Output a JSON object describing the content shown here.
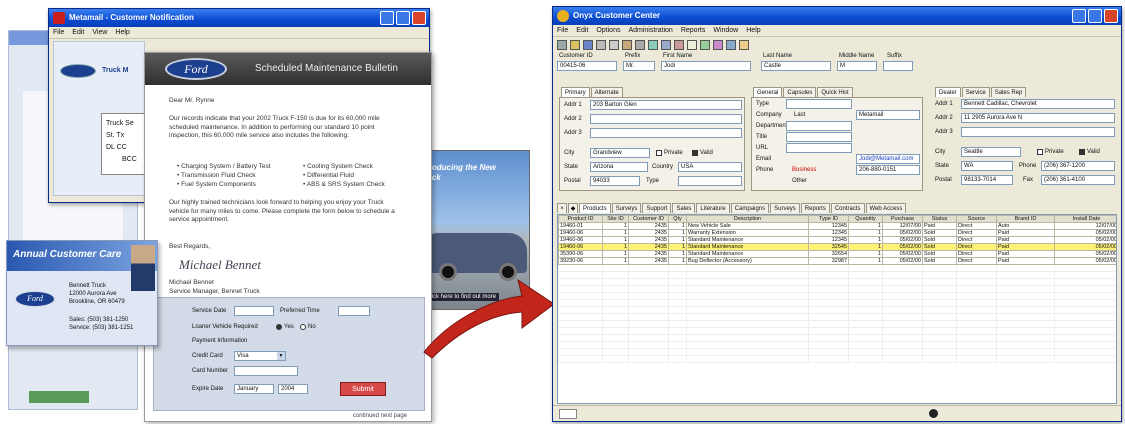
{
  "left_back": {
    "title": "Metamail - Customer Notification",
    "menu": [
      "File",
      "Edit",
      "View",
      "Help"
    ],
    "truck_label": "Truck M",
    "panel_lines": [
      "Truck Se",
      "St. Tx",
      "DL   CC",
      "BCC"
    ]
  },
  "bulletin": {
    "brand": "Ford",
    "header_title": "Scheduled Maintenance Bulletin",
    "greeting": "Dear Mr. Rynne",
    "para1": "Our records indicate that your 2002 Truck F-150 is due for its 60,000 mile scheduled maintenance. In addition to performing our standard 10 point inspection, this 60,000 mile service also includes the following:",
    "checklist": [
      "Charging System / Battery Test",
      "Transmission Fluid Check",
      "Fuel System Components",
      "Cooling System Check",
      "Differential Fluid",
      "ABS & SRS System Check"
    ],
    "para2": "Our highly trained technicians look forward to helping you enjoy your Truck vehicle for many miles to come. Please complete the form below to schedule a service appointment.",
    "closing": "Best Regards,",
    "signature": "Michael Bennet",
    "sig_name": "Michael Bennet",
    "sig_title": "Service Manager, Bennet Truck",
    "form": {
      "service_date": "Service Date",
      "preferred_time": "Preferred Time",
      "loaner": "Loaner Vehicle Required",
      "yes": "Yes",
      "no": "No",
      "payment": "Payment Information",
      "credit_card": "Credit Card",
      "credit_card_value": "Visa",
      "card_number": "Card Number",
      "expire_date": "Expire Date",
      "expire_month": "January",
      "expire_year": "2004",
      "submit": "Submit"
    },
    "footer": "continued next page"
  },
  "promo": {
    "headline": "Introducing the New Truck",
    "caption": "Click here to find out more"
  },
  "card": {
    "title": "Annual Customer Care",
    "brand": "Ford",
    "company": "Bennett Truck",
    "addr1": "12000 Aurora Ave",
    "addr2": "Brookline, OR 60479",
    "sales": "Sales: (503) 381-1250",
    "service": "Service: (503) 381-1251"
  },
  "onyx": {
    "title": "Onyx Customer Center",
    "menu": [
      "File",
      "Edit",
      "Options",
      "Administration",
      "Reports",
      "Window",
      "Help"
    ],
    "name_labels": [
      "Customer ID",
      "Prefix",
      "First Name",
      "Last Name",
      "Middle Name",
      "Suffix"
    ],
    "name_values": [
      "00415-06",
      "Mr.",
      "Jodi",
      "Castle",
      "M",
      ""
    ],
    "addr_tabs": [
      "Primary",
      "Alternate"
    ],
    "addr_labels": [
      "Addr 1",
      "Addr 2",
      "Addr 3",
      "City",
      "State",
      "Postal",
      "Country",
      "Type"
    ],
    "addr1": "203 Barton Glen",
    "city": "Grandview",
    "state": "Arizona",
    "postal": "94033",
    "country": "USA",
    "private": "Private",
    "valid": "Valid",
    "gen_tabs": [
      "General",
      "Capsules",
      "Quick Hist"
    ],
    "gen_labels": [
      "Type",
      "Company",
      "Department",
      "Title",
      "URL",
      "Email",
      "Phone",
      "Other"
    ],
    "company_value": "Metamail",
    "last_label": "Last",
    "email_value": "Jodi@Metamail.com",
    "phone_type": "Business",
    "phone_value": "206-880-0151",
    "dealer_tabs": [
      "Dealer",
      "Service",
      "Sales Rep"
    ],
    "dealer_addr1": "Bennett Cadillac, Chevrolet",
    "dealer_addr2": "11 2905 Aurora Ave N",
    "dealer_city": "Seattle",
    "dealer_state": "WA",
    "dealer_postal": "98133-7014",
    "dealer_phone_label": "Phone",
    "dealer_phone": "(206) 367-1200",
    "dealer_fax_label": "Fax",
    "dealer_fax": "(206) 361-4100",
    "bottom_tabs": [
      "Products",
      "Surveys",
      "Support",
      "Sales",
      "Literature",
      "Campaigns",
      "Surveys",
      "Reports",
      "Contracts",
      "Web Access"
    ],
    "columns": [
      "Product ID",
      "Site ID",
      "Customer ID",
      "Qty",
      "Description",
      "Type ID",
      "Quantity",
      "Purchase",
      "Status",
      "Source",
      "Brand ID",
      "Install Date"
    ],
    "rows": [
      [
        "19460-01",
        "1",
        "2435",
        "1",
        "New Vehicle Sale",
        "12345",
        "1",
        "12/07/00",
        "Paid",
        "Direct",
        "Auto",
        "12/07/00"
      ],
      [
        "19460-06",
        "1",
        "2435",
        "1",
        "Warranty Extension",
        "12345",
        "1",
        "05/02/00",
        "Sold",
        "Direct",
        "Paid",
        "05/02/00"
      ],
      [
        "19460-06",
        "1",
        "2435",
        "1",
        "Standard Maintenance",
        "12345",
        "1",
        "05/02/00",
        "Sold",
        "Direct",
        "Paid",
        "05/02/00"
      ],
      [
        "19460-06",
        "1",
        "2435",
        "1",
        "Standard Maintenance",
        "32545",
        "1",
        "05/02/00",
        "Sold",
        "Direct",
        "Paid",
        "05/02/00"
      ],
      [
        "35390-06",
        "1",
        "2435",
        "1",
        "Standard Maintenance",
        "32654",
        "1",
        "05/02/00",
        "Sold",
        "Direct",
        "Paid",
        "05/02/00"
      ],
      [
        "39230-06",
        "1",
        "2435",
        "1",
        "Bug Deflector (Accessory)",
        "32987",
        "1",
        "05/02/00",
        "Sold",
        "Direct",
        "Paid",
        "05/02/00"
      ]
    ],
    "highlight_row": 3
  },
  "colors": {
    "titlebar": "#0a4bd0",
    "ford_blue": "#1c3f8f",
    "arrow_red": "#c2261b",
    "highlight": "#fff176"
  }
}
